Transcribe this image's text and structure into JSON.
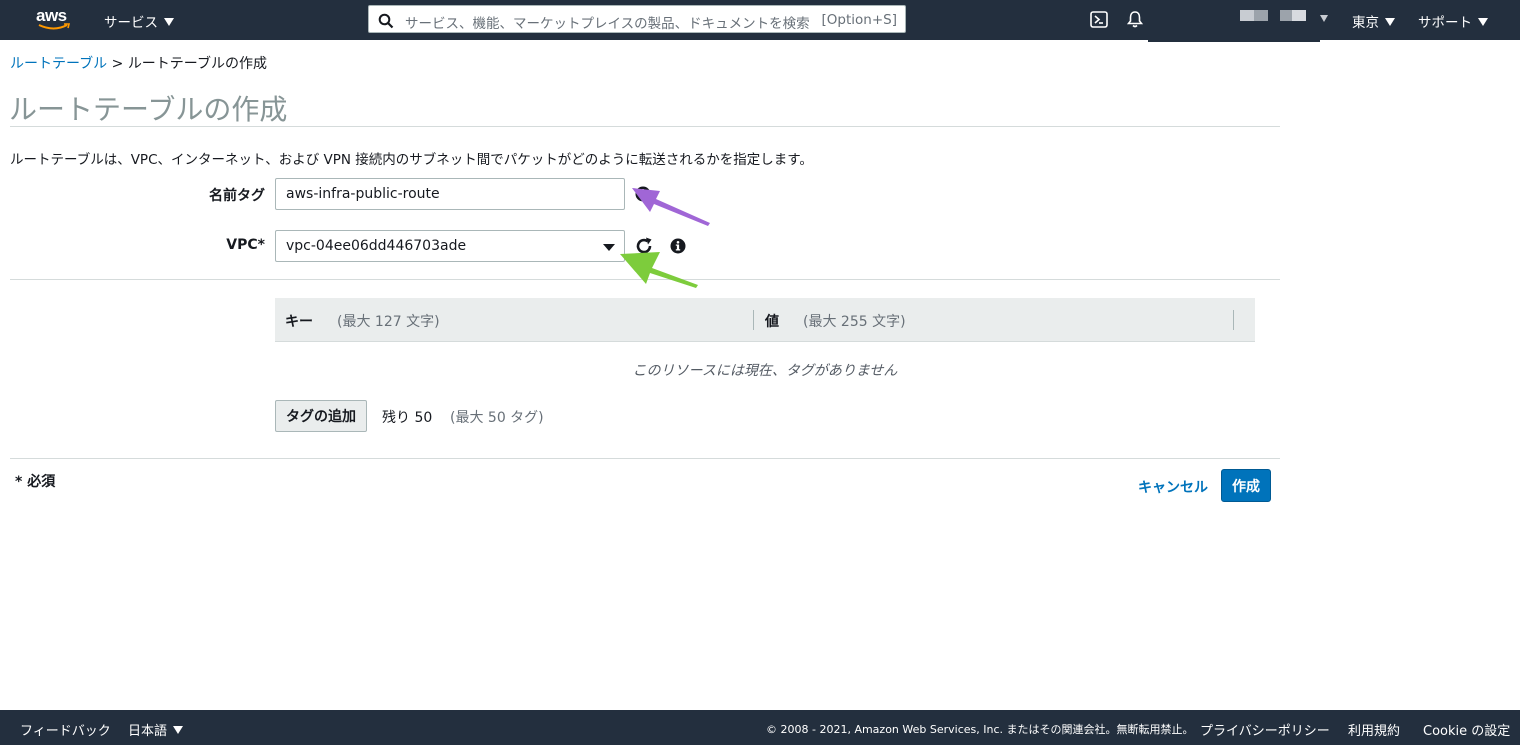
{
  "topnav": {
    "logo_text": "aws",
    "services_label": "サービス",
    "search_placeholder": "サービス、機能、マーケットプレイスの製品、ドキュメントを検索",
    "search_shortcut": "[Option+S]",
    "region_label": "東京",
    "support_label": "サポート",
    "icons": [
      "cloudshell-icon",
      "bell-icon",
      "search-icon",
      "aws-logo-icon"
    ]
  },
  "breadcrumb": {
    "parent": "ルートテーブル",
    "separator": ">",
    "current": "ルートテーブルの作成"
  },
  "page": {
    "title": "ルートテーブルの作成",
    "description": "ルートテーブルは、VPC、インターネット、および VPN 接続内のサブネット間でパケットがどのように転送されるかを指定します。"
  },
  "form": {
    "name_tag_label": "名前タグ",
    "name_tag_value": "aws-infra-public-route",
    "vpc_label": "VPC*",
    "vpc_value": "vpc-04ee06dd446703ade"
  },
  "tags": {
    "key_header": "キー",
    "key_hint": "(最大 127 文字)",
    "value_header": "値",
    "value_hint": "(最大 255 文字)",
    "empty_message": "このリソースには現在、タグがありません",
    "add_button": "タグの追加",
    "remaining": "残り 50",
    "max": "(最大 50 タグ)"
  },
  "actions": {
    "required_note": "* 必須",
    "cancel": "キャンセル",
    "create": "作成",
    "primary_color": "#0073bb"
  },
  "annotations": {
    "arrow_purple_color": "#a066d6",
    "arrow_green_color": "#7dcc3c"
  },
  "footer": {
    "feedback": "フィードバック",
    "language": "日本語",
    "copyright": "© 2008 - 2021, Amazon Web Services, Inc. またはその関連会社。無断転用禁止。",
    "privacy": "プライバシーポリシー",
    "terms": "利用規約",
    "cookie": "Cookie の設定"
  }
}
